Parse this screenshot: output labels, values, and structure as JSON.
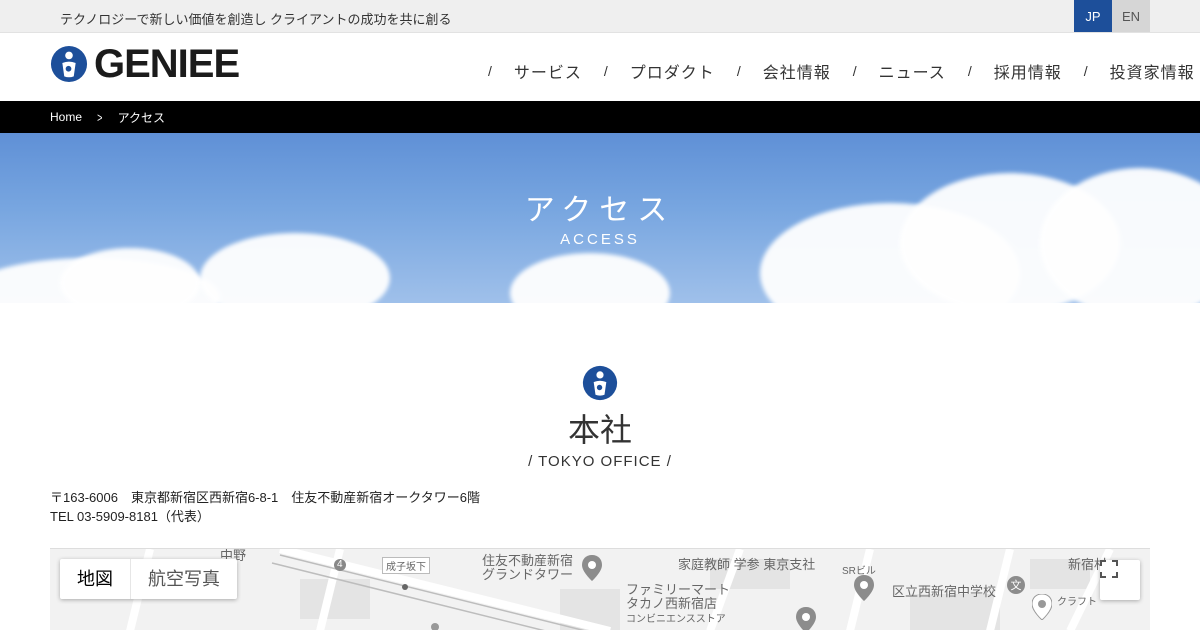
{
  "topbar": {
    "tagline": "テクノロジーで新しい価値を創造し クライアントの成功を共に創る",
    "lang_jp": "JP",
    "lang_en": "EN"
  },
  "header": {
    "logo_text": "GENIEE",
    "nav": [
      {
        "label": "サービス"
      },
      {
        "label": "プロダクト"
      },
      {
        "label": "会社情報"
      },
      {
        "label": "ニュース"
      },
      {
        "label": "採用情報"
      },
      {
        "label": "投資家情報"
      }
    ],
    "nav_separator": "/"
  },
  "breadcrumb": {
    "home": "Home",
    "current": "アクセス"
  },
  "hero": {
    "title": "アクセス",
    "subtitle": "ACCESS"
  },
  "office": {
    "title": "本社",
    "subtitle": "/ TOKYO OFFICE /",
    "address": "〒163-6006　東京都新宿区西新宿6-8-1　住友不動産新宿オークタワー6階",
    "tel": "TEL 03-5909-8181（代表）"
  },
  "map": {
    "tab_map": "地図",
    "tab_satellite": "航空写真",
    "labels": {
      "naruko": "成子坂下",
      "sumitomo_1": "住友不動産新宿",
      "sumitomo_2": "グランドタワー",
      "katei": "家庭教師 学参 東京支社",
      "family_1": "ファミリーマート",
      "family_2": "タカノ西新宿店",
      "family_3": "コンビニエンスストア",
      "sr": "SRビル",
      "school": "区立西新宿中学校",
      "craft": "クラフト",
      "shinjuku_top": "新宿村",
      "nakano": "中野",
      "route": "4"
    }
  },
  "colors": {
    "brand_blue": "#1d4f9a",
    "header_bg": "#ffffff",
    "breadcrumb_bg": "#000000",
    "topbar_bg": "#efefef"
  },
  "icons": {
    "logo_mark": "geniee-logo-icon",
    "office_mark": "geniee-mark-icon",
    "breadcrumb_sep": "chevron-right-icon",
    "fullscreen": "fullscreen-icon",
    "map_pin": "map-pin-icon"
  }
}
